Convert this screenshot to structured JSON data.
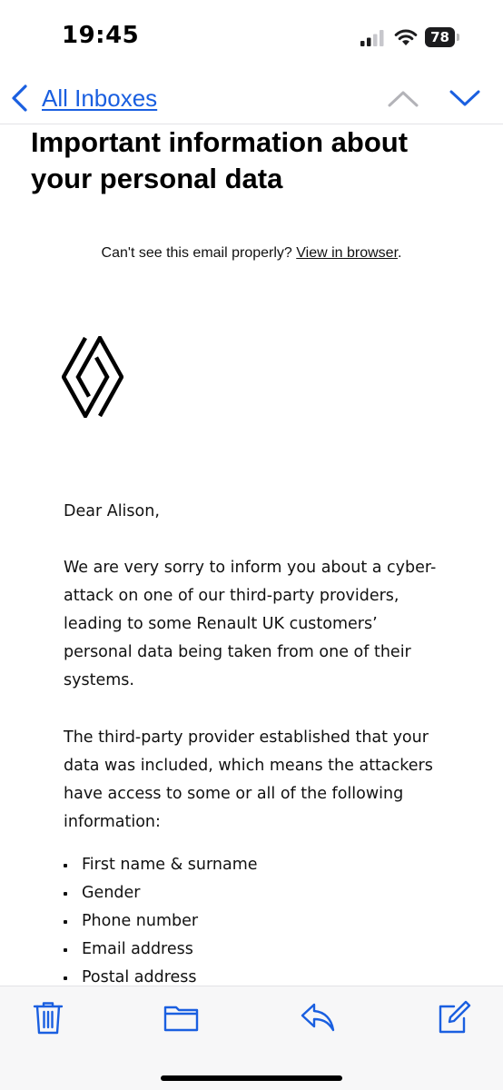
{
  "status_bar": {
    "time": "19:45",
    "battery_level": "78"
  },
  "nav": {
    "back_label": "All Inboxes"
  },
  "email": {
    "subject": "Important information about your personal data",
    "view_in_browser_prefix": "Can't see this email properly? ",
    "view_in_browser_link": "View in browser",
    "view_in_browser_suffix": ".",
    "greeting": "Dear Alison,",
    "paragraph1": "We are very sorry to inform you about a cyber-attack on one of our third-party providers, leading to some Renault UK customers’ personal data being taken from one of their systems.",
    "paragraph2": "The third-party provider established that your data was included, which means the attackers have access to some or all of the following information:",
    "info_items": [
      "First name & surname",
      "Gender",
      "Phone number",
      "Email address",
      "Postal address"
    ]
  },
  "colors": {
    "accent": "#1a5fe0",
    "toolbar_bg": "#f7f7f8"
  },
  "icons": {
    "back": "chevron-left-icon",
    "prev": "chevron-up-icon",
    "next": "chevron-down-icon",
    "trash": "trash-icon",
    "folder": "folder-icon",
    "reply": "reply-icon",
    "compose": "compose-icon"
  }
}
